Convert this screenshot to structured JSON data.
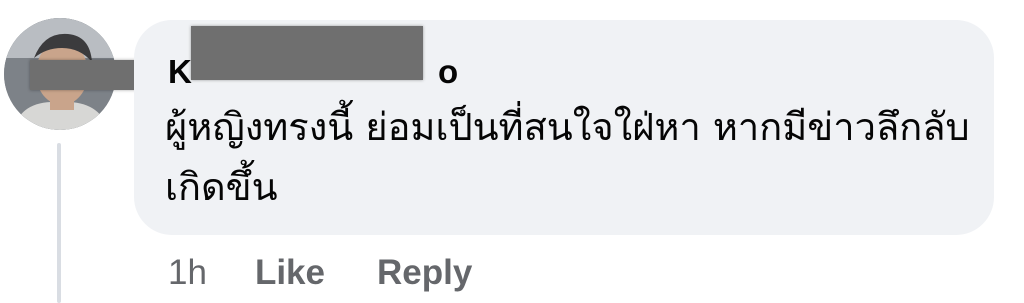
{
  "comment": {
    "author_visible_start": "K",
    "author_visible_end": "o",
    "text": "ผู้หญิงทรงนี้ ย่อมเป็นที่สนใจใฝ่หา หากมีข่าวลึกลับเกิดขึ้น",
    "timestamp": "1h",
    "like_label": "Like",
    "reply_label": "Reply"
  },
  "colors": {
    "bubble": "#f0f2f5",
    "text": "#050505",
    "meta": "#65676b",
    "censor": "#6f6f6f"
  }
}
